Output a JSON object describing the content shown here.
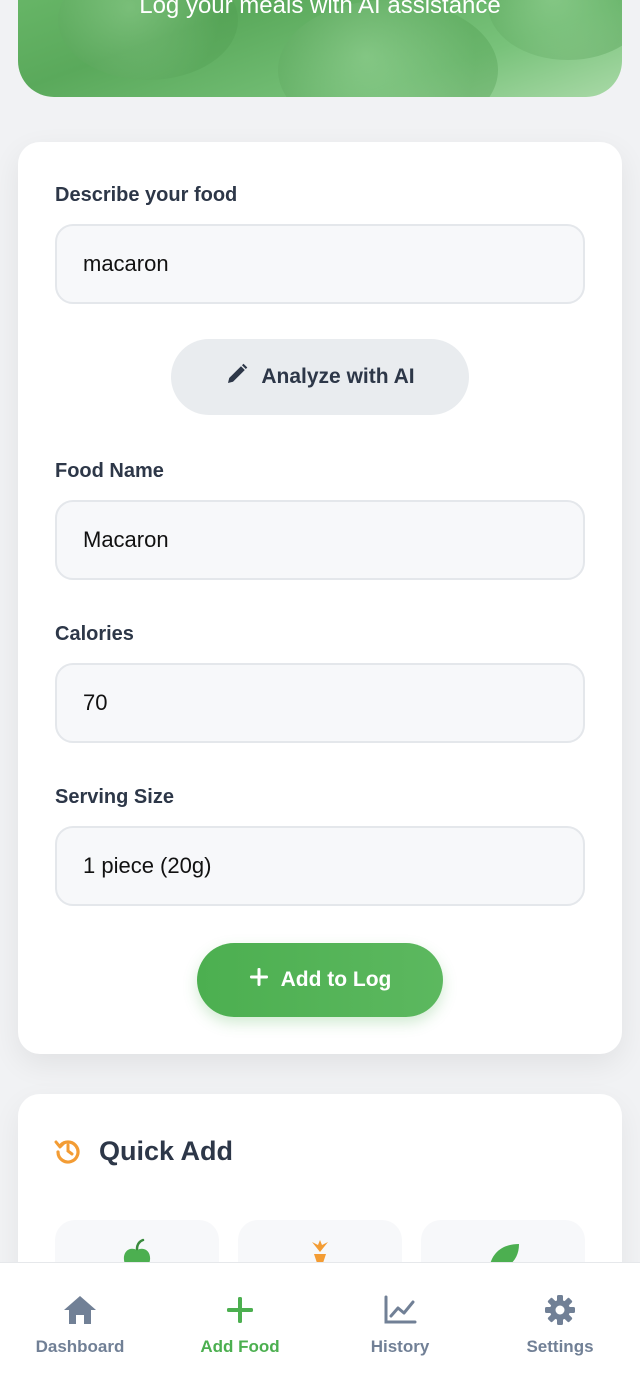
{
  "hero": {
    "subtitle": "Log your meals with AI assistance"
  },
  "form": {
    "describe_label": "Describe your food",
    "describe_value": "macaron",
    "analyze_button": "Analyze with AI",
    "food_name_label": "Food Name",
    "food_name_value": "Macaron",
    "calories_label": "Calories",
    "calories_value": "70",
    "serving_label": "Serving Size",
    "serving_value": "1 piece (20g)",
    "add_button": "Add to Log"
  },
  "quick_add": {
    "title": "Quick Add",
    "icons": [
      "history-icon",
      "apple-icon",
      "carrot-icon",
      "leaf-icon"
    ]
  },
  "nav": {
    "items": [
      {
        "label": "Dashboard",
        "icon": "home-icon",
        "active": false
      },
      {
        "label": "Add Food",
        "icon": "plus-icon",
        "active": true
      },
      {
        "label": "History",
        "icon": "chart-line-icon",
        "active": false
      },
      {
        "label": "Settings",
        "icon": "gear-icon",
        "active": false
      }
    ]
  },
  "colors": {
    "accent": "#4caf50",
    "orange": "#f39c34",
    "text": "#2d3748",
    "muted": "#718096"
  }
}
